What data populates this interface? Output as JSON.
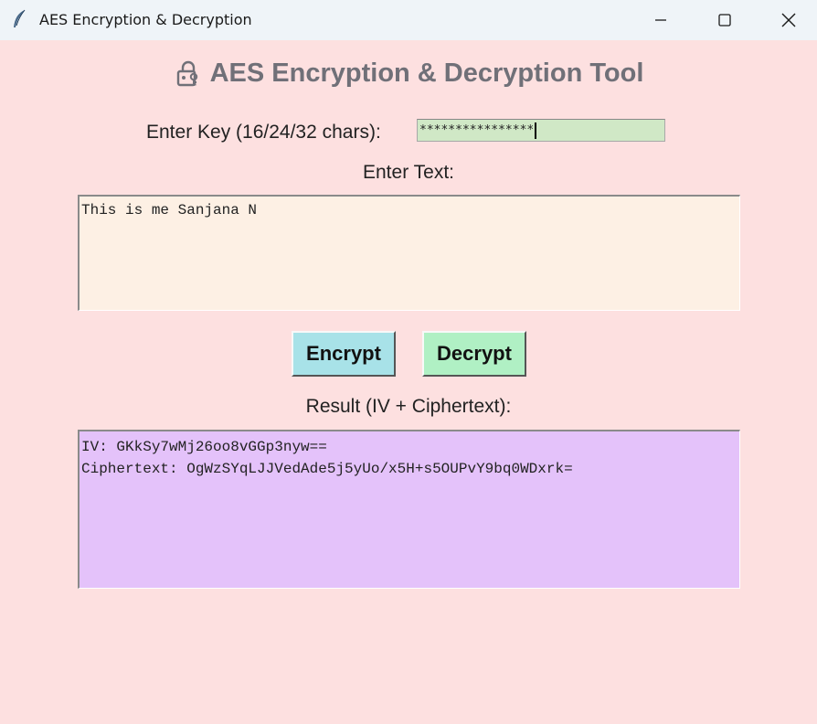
{
  "window": {
    "title": "AES Encryption & Decryption"
  },
  "app": {
    "heading": "AES Encryption & Decryption Tool",
    "heading_icon": "lock-key-icon"
  },
  "key": {
    "label": "Enter Key (16/24/32 chars):",
    "masked_value": "****************"
  },
  "text": {
    "label": "Enter Text:",
    "value": "This is me Sanjana N"
  },
  "buttons": {
    "encrypt": "Encrypt",
    "decrypt": "Decrypt"
  },
  "result": {
    "label": "Result (IV + Ciphertext):",
    "lines": [
      "IV: GKkSy7wMj26oo8vGGp3nyw==",
      "Ciphertext: OgWzSYqLJJVedAde5j5yUo/x5H+s5OUPvY9bq0WDxrk="
    ]
  },
  "colors": {
    "background": "#fde0e0",
    "key_field": "#d0e8c6",
    "text_field": "#fdf0e4",
    "result_field": "#e4c2fa",
    "encrypt_button": "#a8e2e8",
    "decrypt_button": "#b0f0c4",
    "heading_text": "#707078"
  }
}
